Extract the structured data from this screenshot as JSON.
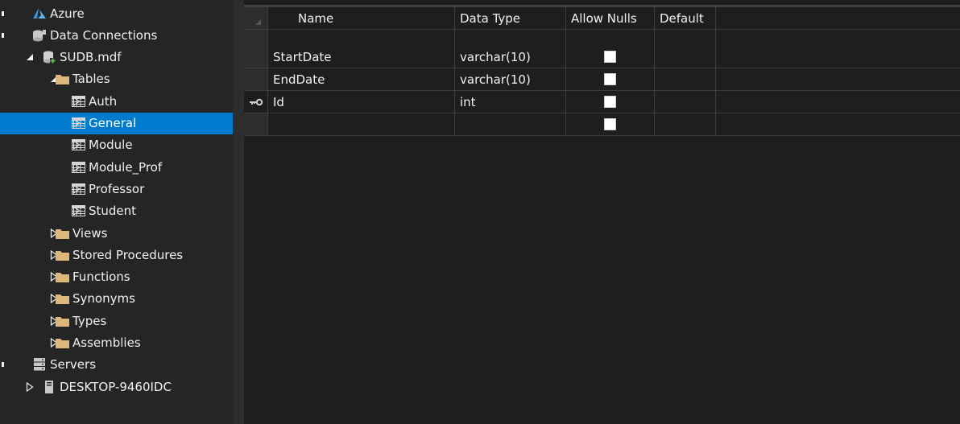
{
  "explorer": {
    "nodes": [
      {
        "label": "Azure",
        "icon": "azure-icon",
        "depth": 0,
        "expander": "none"
      },
      {
        "label": "Data Connections",
        "icon": "data-connections-icon",
        "depth": 0,
        "expander": "none"
      },
      {
        "label": "SUDB.mdf",
        "icon": "database-icon",
        "depth": 1,
        "expander": "expanded"
      },
      {
        "label": "Tables",
        "icon": "folder-icon",
        "depth": 2,
        "expander": "expanded"
      },
      {
        "label": "Auth",
        "icon": "table-icon",
        "depth": 3,
        "expander": "collapsed"
      },
      {
        "label": "General",
        "icon": "table-icon",
        "depth": 3,
        "expander": "collapsed",
        "selected": true
      },
      {
        "label": "Module",
        "icon": "table-icon",
        "depth": 3,
        "expander": "collapsed"
      },
      {
        "label": "Module_Prof",
        "icon": "table-icon",
        "depth": 3,
        "expander": "collapsed"
      },
      {
        "label": "Professor",
        "icon": "table-icon",
        "depth": 3,
        "expander": "collapsed"
      },
      {
        "label": "Student",
        "icon": "table-icon",
        "depth": 3,
        "expander": "collapsed"
      },
      {
        "label": "Views",
        "icon": "folder-icon",
        "depth": 2,
        "expander": "collapsed"
      },
      {
        "label": "Stored Procedures",
        "icon": "folder-icon",
        "depth": 2,
        "expander": "collapsed"
      },
      {
        "label": "Functions",
        "icon": "folder-icon",
        "depth": 2,
        "expander": "collapsed"
      },
      {
        "label": "Synonyms",
        "icon": "folder-icon",
        "depth": 2,
        "expander": "collapsed"
      },
      {
        "label": "Types",
        "icon": "folder-icon",
        "depth": 2,
        "expander": "collapsed"
      },
      {
        "label": "Assemblies",
        "icon": "folder-icon",
        "depth": 2,
        "expander": "collapsed"
      },
      {
        "label": "Servers",
        "icon": "servers-icon",
        "depth": 0,
        "expander": "none"
      },
      {
        "label": "DESKTOP-9460IDC",
        "icon": "computer-icon",
        "depth": 1,
        "expander": "collapsed"
      }
    ]
  },
  "designer": {
    "columns": {
      "name": "Name",
      "data_type": "Data Type",
      "allow_nulls": "Allow Nulls",
      "default": "Default"
    },
    "rows": [
      {
        "name": "StartDate",
        "data_type": "varchar(10)",
        "allow_nulls": false,
        "primary_key": false
      },
      {
        "name": "EndDate",
        "data_type": "varchar(10)",
        "allow_nulls": false,
        "primary_key": false
      },
      {
        "name": "Id",
        "data_type": "int",
        "allow_nulls": false,
        "primary_key": true
      },
      {
        "name": "",
        "data_type": "",
        "allow_nulls": false,
        "primary_key": false
      }
    ]
  },
  "colors": {
    "selection": "#007acc",
    "panel": "#252526",
    "editor": "#1e1e1e",
    "folder": "#dcb67a",
    "azure": "#3a96dd"
  }
}
